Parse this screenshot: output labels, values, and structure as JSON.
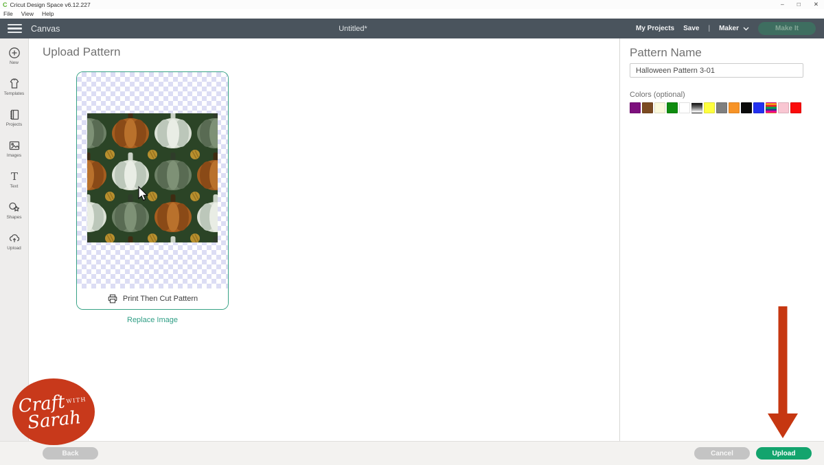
{
  "window": {
    "app_title": "Cricut Design Space  v6.12.227",
    "logo_glyph": "C",
    "menu_items": [
      "File",
      "View",
      "Help"
    ],
    "controls": {
      "minimize": "–",
      "maximize": "□",
      "close": "✕"
    }
  },
  "header": {
    "canvas_label": "Canvas",
    "document_title": "Untitled*",
    "my_projects": "My Projects",
    "save": "Save",
    "separator": "|",
    "machine": "Maker",
    "make_it": "Make It"
  },
  "sidebar": {
    "items": [
      {
        "label": "New",
        "icon": "plus-circle-icon"
      },
      {
        "label": "Templates",
        "icon": "tshirt-icon"
      },
      {
        "label": "Projects",
        "icon": "projects-book-icon"
      },
      {
        "label": "Images",
        "icon": "images-icon"
      },
      {
        "label": "Text",
        "icon": "text-icon"
      },
      {
        "label": "Shapes",
        "icon": "shapes-icon"
      },
      {
        "label": "Upload",
        "icon": "upload-cloud-icon"
      }
    ]
  },
  "main": {
    "title": "Upload Pattern",
    "print_then_cut_label": "Print Then Cut Pattern",
    "replace_image_label": "Replace Image",
    "pattern_preview": {
      "description": "Seamless Halloween pumpkin pattern with gold dots on dark green",
      "background": "#2b4426",
      "pumpkin_orange": "#a55d1f",
      "pumpkin_cream": "#dbe1d6",
      "pumpkin_sage": "#6d8066",
      "dot_gold": "#b8902f"
    }
  },
  "right_panel": {
    "title": "Pattern Name",
    "name_value": "Halloween Pattern 3-01",
    "colors_label": "Colors (optional)",
    "swatches": [
      {
        "name": "purple",
        "css": "background:#7d107d"
      },
      {
        "name": "brown",
        "css": "background:#7c4b22"
      },
      {
        "name": "cream",
        "css": "background:#fbf9dc"
      },
      {
        "name": "green",
        "css": "background:#0f8c0f"
      },
      {
        "name": "white",
        "css": "background:#ffffff"
      },
      {
        "name": "black-white-gradient",
        "css": "background:linear-gradient(180deg,#0b0b0b,#6e6e6e 45%,#ffffff 95%)"
      },
      {
        "name": "yellow",
        "css": "background:#ffff3e"
      },
      {
        "name": "gray",
        "css": "background:#7f7f7f"
      },
      {
        "name": "orange",
        "css": "background:#f79327"
      },
      {
        "name": "black",
        "css": "background:#0a0a0a"
      },
      {
        "name": "blue",
        "css": "background:#2431f0"
      },
      {
        "name": "rainbow",
        "css": "background:linear-gradient(180deg,#f7941d 0 20%,#ee1c24 20% 40%,#00a650 40% 60%,#2e3192 60% 80%,#ec008c 80% 100%)"
      },
      {
        "name": "pink",
        "css": "background:#f9c6d2"
      },
      {
        "name": "red",
        "css": "background:#fb0b0b"
      }
    ]
  },
  "footer": {
    "back": "Back",
    "cancel": "Cancel",
    "upload": "Upload"
  },
  "annotations": {
    "arrow_color": "#c63711",
    "logo": {
      "line1": "Craft",
      "line2": "with",
      "line3": "Sarah"
    }
  },
  "colors": {
    "header_bg": "#4a545d",
    "accent_teal": "#2f9e85",
    "upload_green": "#13a46d",
    "logo_red": "#c8391b"
  }
}
